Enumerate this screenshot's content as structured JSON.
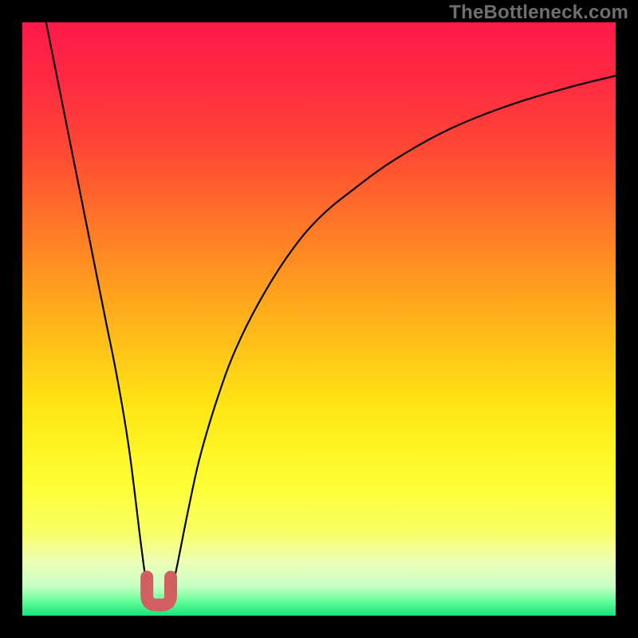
{
  "watermark": "TheBottleneck.com",
  "colors": {
    "frame": "#000000",
    "curve": "#000000",
    "marker": "#d15e61",
    "gradient_stops": [
      {
        "offset": 0.0,
        "color": "#ff1a4a"
      },
      {
        "offset": 0.1,
        "color": "#ff2a42"
      },
      {
        "offset": 0.22,
        "color": "#ff4a34"
      },
      {
        "offset": 0.35,
        "color": "#ff7a26"
      },
      {
        "offset": 0.5,
        "color": "#ffb21a"
      },
      {
        "offset": 0.65,
        "color": "#ffe714"
      },
      {
        "offset": 0.78,
        "color": "#feff34"
      },
      {
        "offset": 0.86,
        "color": "#f8ff66"
      },
      {
        "offset": 0.91,
        "color": "#ecffb7"
      },
      {
        "offset": 0.95,
        "color": "#c9ffc4"
      },
      {
        "offset": 0.975,
        "color": "#67ff9b"
      },
      {
        "offset": 1.0,
        "color": "#18e27a"
      }
    ]
  },
  "chart_data": {
    "type": "line",
    "title": "",
    "xlabel": "",
    "ylabel": "",
    "xlim": [
      0,
      100
    ],
    "ylim": [
      0,
      100
    ],
    "grid": false,
    "series": [
      {
        "name": "bottleneck-curve",
        "x": [
          4,
          6,
          8,
          10,
          12,
          14,
          16,
          18,
          20,
          21,
          22,
          23,
          24,
          25,
          26,
          28,
          30,
          33,
          36,
          40,
          45,
          50,
          56,
          63,
          72,
          82,
          92,
          100
        ],
        "y": [
          100,
          90,
          80,
          70,
          60,
          50,
          40,
          28,
          12,
          5,
          2,
          2,
          2,
          4,
          8,
          18,
          27,
          37,
          45,
          53,
          61,
          67,
          72,
          77,
          82,
          86,
          89,
          91
        ]
      }
    ],
    "marker": {
      "name": "optimal-range",
      "x_range": [
        21,
        25
      ],
      "y": 3,
      "shape": "U"
    }
  }
}
